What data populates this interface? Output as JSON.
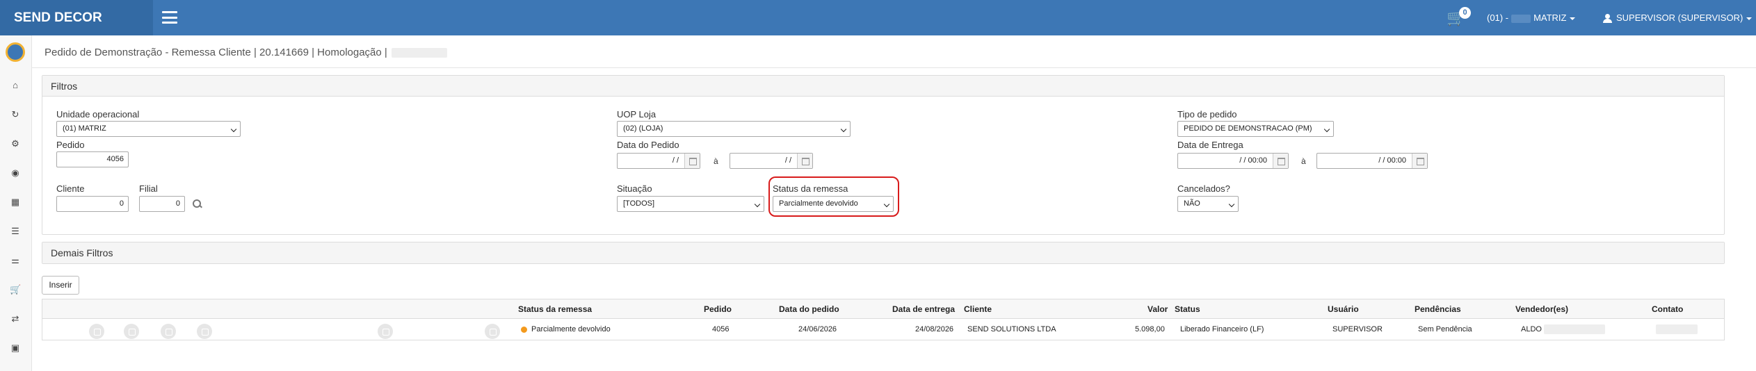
{
  "app": {
    "brand": "SEND DECOR"
  },
  "header": {
    "cart_count": "0",
    "unit_prefix": "(01) -",
    "unit_name": "MATRIZ",
    "user": "SUPERVISOR (SUPERVISOR)"
  },
  "sidebar": {
    "icons": [
      "home-icon",
      "spinner-icon",
      "cogs-icon",
      "circle-icon",
      "cube-icon",
      "database-icon",
      "sliders-icon",
      "cart-icon",
      "exchange-icon",
      "briefcase-icon"
    ]
  },
  "page": {
    "title": "Pedido de Demonstração - Remessa Cliente | 20.141669 | Homologação |"
  },
  "filters": {
    "panel_title": "Filtros",
    "unidade_label": "Unidade operacional",
    "unidade_value": "(01)        MATRIZ",
    "uop_label": "UOP Loja",
    "uop_value": "(02)              (LOJA)",
    "tipo_label": "Tipo de pedido",
    "tipo_value": "PEDIDO DE DEMONSTRACAO (PM)",
    "pedido_label": "Pedido",
    "pedido_value": "4056",
    "data_pedido_label": "Data do Pedido",
    "data_pedido_from": "/ /",
    "data_pedido_to": "/ /",
    "a_label": "à",
    "data_entrega_label": "Data de Entrega",
    "data_entrega_from": "/ /      00:00",
    "data_entrega_to": "/ /      00:00",
    "cliente_label": "Cliente",
    "cliente_value": "0",
    "filial_label": "Filial",
    "filial_value": "0",
    "situacao_label": "Situação",
    "situacao_value": "[TODOS]",
    "status_remessa_label": "Status da remessa",
    "status_remessa_value": "Parcialmente devolvido",
    "cancelados_label": "Cancelados?",
    "cancelados_value": "NÃO"
  },
  "demais": {
    "panel_title": "Demais Filtros"
  },
  "actions": {
    "inserir": "Inserir"
  },
  "table": {
    "headers": {
      "status_remessa": "Status da remessa",
      "pedido": "Pedido",
      "data_pedido": "Data do pedido",
      "data_entrega": "Data de entrega",
      "cliente": "Cliente",
      "valor": "Valor",
      "status": "Status",
      "usuario": "Usuário",
      "pendencias": "Pendências",
      "vendedores": "Vendedor(es)",
      "contato": "Contato"
    },
    "rows": [
      {
        "status_remessa": "Parcialmente devolvido",
        "status_color": "#f39a1d",
        "pedido": "4056",
        "data_pedido": "24/06/2026",
        "data_entrega": "24/08/2026",
        "cliente": "SEND SOLUTIONS LTDA",
        "valor": "5.098,00",
        "status": "Liberado Financeiro (LF)",
        "usuario": "SUPERVISOR",
        "pendencias": "Sem Pendência",
        "vendedor": "ALDO"
      }
    ]
  },
  "colors": {
    "header_bg": "#3d77b5",
    "brand_bg": "#336aa4",
    "highlight": "#d81b1b"
  }
}
